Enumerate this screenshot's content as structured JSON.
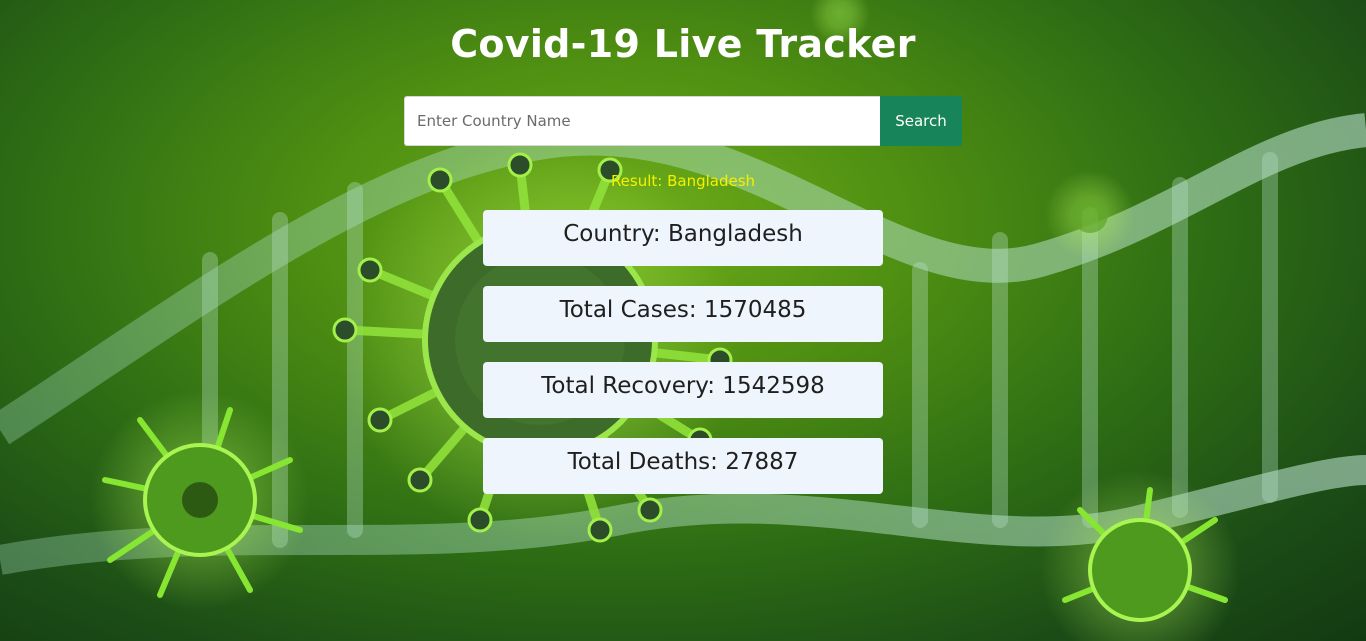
{
  "header": {
    "title": "Covid-19 Live Tracker"
  },
  "search": {
    "placeholder": "Enter Country Name",
    "value": "",
    "button_label": "Search"
  },
  "result": {
    "text": "Result: Bangladesh"
  },
  "stats": {
    "country": "Country: Bangladesh",
    "total_cases": "Total Cases: 1570485",
    "total_recovery": "Total Recovery: 1542598",
    "total_deaths": "Total Deaths: 27887"
  },
  "colors": {
    "search_button": "#18845a",
    "result_text": "#f5f000",
    "card_background": "#eef5fc",
    "title_text": "#ffffff"
  },
  "background": {
    "icon": "virus-dna-illustration"
  }
}
